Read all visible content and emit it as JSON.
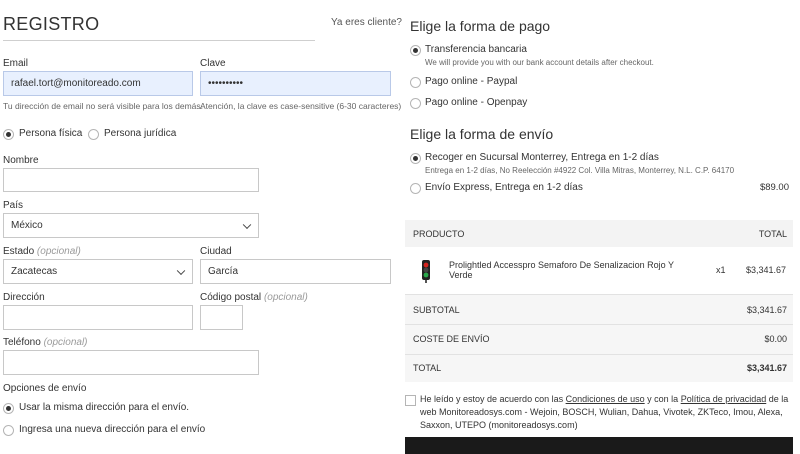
{
  "registro": {
    "title": "REGISTRO",
    "already_client": "Ya eres cliente?",
    "email_label": "Email",
    "email_value": "rafael.tort@monitoreado.com",
    "email_hint": "Tu dirección de email no será visible para los demás.",
    "password_label": "Clave",
    "password_value": "••••••••••",
    "password_hint": "Atención, la clave es case-sensitive (6-30 caracteres)",
    "persona_fisica": "Persona física",
    "persona_juridica": "Persona jurídica",
    "nombre_label": "Nombre",
    "pais_label": "País",
    "pais_value": "México",
    "estado_label": "Estado",
    "estado_optional": "(opcional)",
    "estado_value": "Zacatecas",
    "ciudad_label": "Ciudad",
    "ciudad_value": "García",
    "direccion_label": "Dirección",
    "postal_label": "Código postal",
    "postal_optional": "(opcional)",
    "telefono_label": "Teléfono",
    "telefono_optional": "(opcional)",
    "envio_opciones_label": "Opciones de envío",
    "envio_misma": "Usar la misma dirección para el envío.",
    "envio_nueva": "Ingresa una nueva dirección para el envío"
  },
  "pago": {
    "title": "Elige la forma de pago",
    "transferencia": "Transferencia bancaria",
    "transferencia_desc": "We will provide you with our bank account details after checkout.",
    "paypal": "Pago online - Paypal",
    "openpay": "Pago online - Openpay"
  },
  "envio": {
    "title": "Elige la forma de envío",
    "sucursal": "Recoger en Sucursal Monterrey, Entrega en 1-2 días",
    "sucursal_desc": "Entrega en 1-2 días, No Reelección #4922 Col. Villa Mitras, Monterrey, N.L. C.P. 64170",
    "express": "Envío Express, Entrega en 1-2 días",
    "express_price": "$89.00"
  },
  "resumen": {
    "header_producto": "PRODUCTO",
    "header_total": "TOTAL",
    "product_name": "Prolightled Accesspro Semaforo De Senalizacion Rojo Y Verde",
    "product_qty": "x1",
    "product_price": "$3,341.67",
    "subtotal_label": "SUBTOTAL",
    "subtotal_value": "$3,341.67",
    "coste_label": "COSTE DE ENVÍO",
    "coste_value": "$0.00",
    "total_label": "TOTAL",
    "total_value": "$3,341.67"
  },
  "terms": {
    "part1": "He leído y estoy de acuerdo con las ",
    "link1": "Condiciones de uso",
    "part2": " y con la ",
    "link2": "Política de privacidad",
    "part3": " de la web ",
    "brands": "Monitoreadosys.com - Wejoin, BOSCH, Wulian, Dahua, Vivotek, ZKTeco, Imou, Alexa, Saxxon, UTEPO",
    "part4": " (monitoreadosys.com)"
  }
}
